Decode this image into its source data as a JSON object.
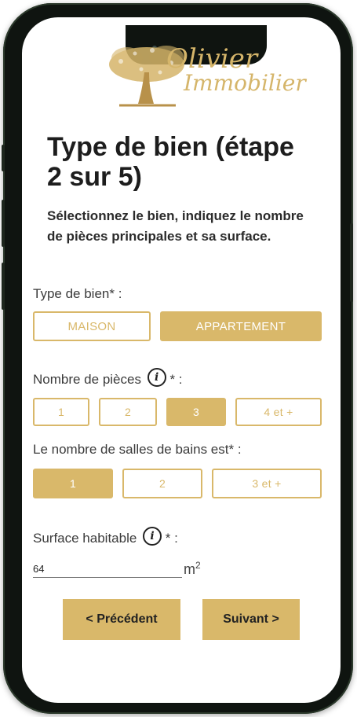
{
  "brand": {
    "line1": "Olivier",
    "line2": "Immobilier",
    "color": "#d5b56a"
  },
  "title": "Type de bien (étape 2 sur 5)",
  "subtitle": "Sélectionnez le bien, indiquez le nombre de pièces principales et sa surface.",
  "property_type": {
    "label": "Type de bien* :",
    "options": [
      {
        "label": "MAISON",
        "selected": false
      },
      {
        "label": "APPARTEMENT",
        "selected": true
      }
    ]
  },
  "rooms": {
    "label": "Nombre de pièces",
    "suffix": "* :",
    "info_glyph": "i",
    "options": [
      {
        "label": "1",
        "selected": false
      },
      {
        "label": "2",
        "selected": false
      },
      {
        "label": "3",
        "selected": true
      },
      {
        "label": "4 et +",
        "selected": false
      }
    ]
  },
  "bathrooms": {
    "label": "Le nombre de salles de bains est* :",
    "options": [
      {
        "label": "1",
        "selected": true
      },
      {
        "label": "2",
        "selected": false
      },
      {
        "label": "3 et +",
        "selected": false
      }
    ]
  },
  "surface": {
    "label": "Surface habitable",
    "suffix": "* :",
    "info_glyph": "i",
    "value": "64",
    "unit": "m",
    "unit_exp": "2"
  },
  "nav": {
    "prev_label": "< Précédent",
    "next_label": "Suivant >"
  },
  "colors": {
    "accent": "#d9b86a",
    "text": "#1d1d1d"
  }
}
